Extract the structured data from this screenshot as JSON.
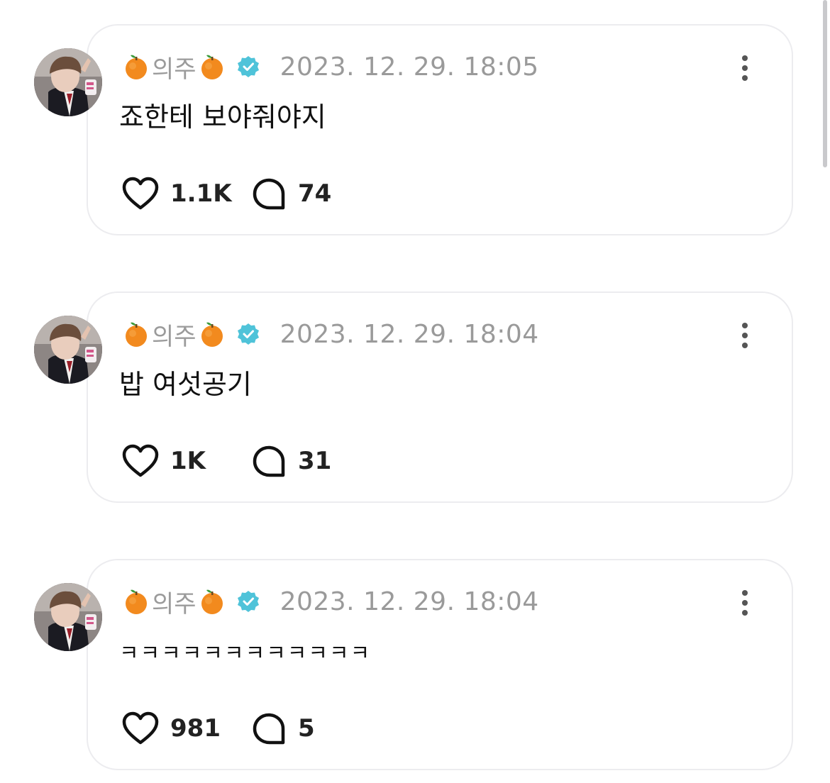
{
  "posts": [
    {
      "username": "의주",
      "timestamp": "2023. 12. 29. 18:05",
      "text": "죠한테 보야줘야지",
      "likes": "1.1K",
      "replies": "74"
    },
    {
      "username": "의주",
      "timestamp": "2023. 12. 29. 18:04",
      "text": "밥 여섯공기",
      "likes": "1K",
      "replies": "31"
    },
    {
      "username": "의주",
      "timestamp": "2023. 12. 29. 18:04",
      "text": "ㅋㅋㅋㅋㅋㅋㅋㅋㅋㅋㅋㅋ",
      "likes": "981",
      "replies": "5"
    }
  ],
  "icons": {
    "name_decoration": "tangerine-emoji",
    "badge": "verified-badge-icon",
    "menu": "more-vertical-icon",
    "like": "heart-icon",
    "reply": "reply-bubble-icon"
  },
  "colors": {
    "verified": "#4fc3d9",
    "muted_text": "#9a9a9a",
    "card_border": "#ececef",
    "orange": "#f28a1e"
  }
}
